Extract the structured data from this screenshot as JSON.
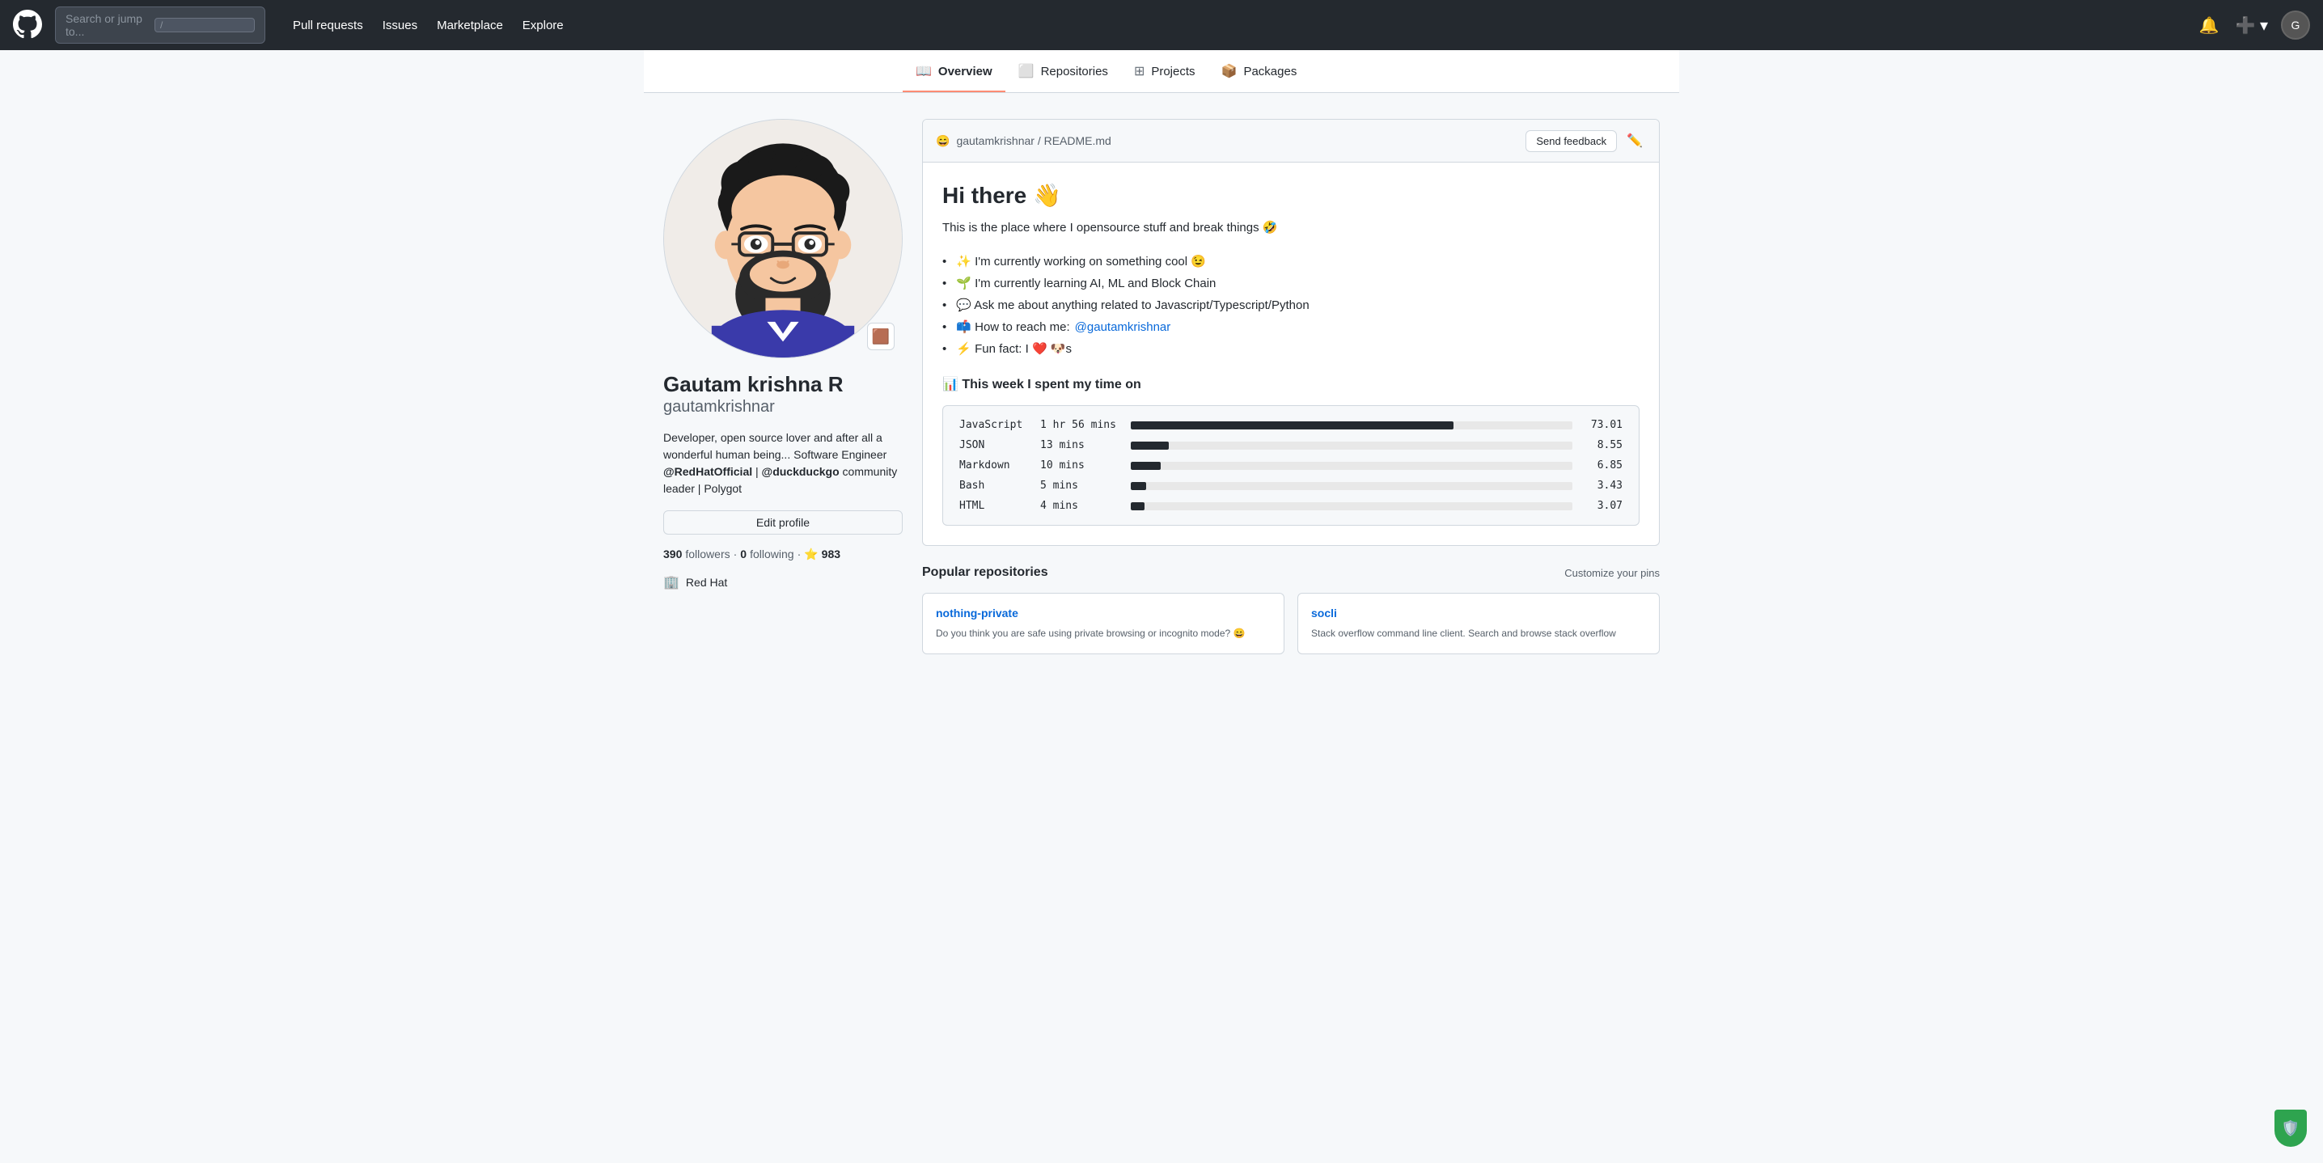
{
  "navbar": {
    "logo_label": "GitHub",
    "search_placeholder": "Search or jump to...",
    "slash_key": "/",
    "nav_links": [
      {
        "label": "Pull requests",
        "href": "#"
      },
      {
        "label": "Issues",
        "href": "#"
      },
      {
        "label": "Marketplace",
        "href": "#"
      },
      {
        "label": "Explore",
        "href": "#"
      }
    ],
    "notification_icon": "bell-icon",
    "plus_icon": "plus-icon",
    "avatar_icon": "user-avatar-icon"
  },
  "profile_tabs": [
    {
      "label": "Overview",
      "icon": "book-icon",
      "active": true
    },
    {
      "label": "Repositories",
      "icon": "repo-icon",
      "active": false
    },
    {
      "label": "Projects",
      "icon": "project-icon",
      "active": false
    },
    {
      "label": "Packages",
      "icon": "package-icon",
      "active": false
    }
  ],
  "sidebar": {
    "full_name": "Gautam krishna R",
    "username": "gautamkrishnar",
    "bio": "Developer, open source lover and after all a wonderful human being... Software Engineer @RedHatOfficial | @duckduckgo community leader | Polygot",
    "edit_profile_label": "Edit profile",
    "followers_count": "390",
    "followers_label": "followers",
    "following_count": "0",
    "following_label": "following",
    "stars_count": "983",
    "org_name": "Red Hat",
    "org_icon": "building-icon",
    "status_emoji": "🟫"
  },
  "readme": {
    "breadcrumb": "gautamkrishnar / README.md",
    "emoji_icon": "😄",
    "send_feedback_label": "Send feedback",
    "edit_icon": "pencil-icon",
    "heading": "Hi there 👋",
    "intro": "This is the place where I opensource stuff and break things 🤣",
    "bullet_1": "✨ I'm currently working on something cool 😉",
    "bullet_2": "🌱 I'm currently learning AI, ML and Block Chain",
    "bullet_3": "💬 Ask me about anything related to Javascript/Typescript/Python",
    "bullet_4_prefix": "📫 How to reach me: ",
    "bullet_4_link": "@gautamkrishnar",
    "bullet_4_href": "#",
    "bullet_5": "⚡ Fun fact: I ❤️ 🐶s",
    "wakatime_title": "📊 This week I spent my time on",
    "wakatime_data": [
      {
        "lang": "JavaScript",
        "time": "1 hr 56 mins",
        "pct": 73.01,
        "pct_label": "73.01"
      },
      {
        "lang": "JSON",
        "time": "13 mins",
        "pct": 8.55,
        "pct_label": "8.55"
      },
      {
        "lang": "Markdown",
        "time": "10 mins",
        "pct": 6.85,
        "pct_label": "6.85"
      },
      {
        "lang": "Bash",
        "time": "5 mins",
        "pct": 3.43,
        "pct_label": "3.43"
      },
      {
        "lang": "HTML",
        "time": "4 mins",
        "pct": 3.07,
        "pct_label": "3.07"
      }
    ]
  },
  "popular_repos": {
    "title": "Popular repositories",
    "customize_pins_label": "Customize your pins",
    "repos": [
      {
        "name": "nothing-private",
        "desc": "Do you think you are safe using private browsing or incognito mode? 😄"
      },
      {
        "name": "socli",
        "desc": "Stack overflow command line client. Search and browse stack overflow"
      }
    ]
  }
}
